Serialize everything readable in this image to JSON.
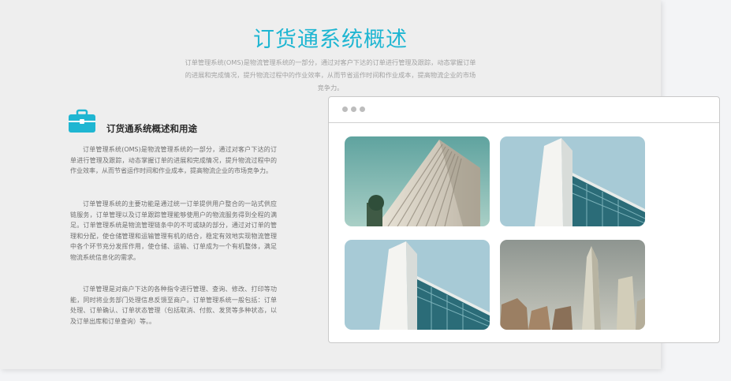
{
  "page": {
    "title": "订货通系统概述",
    "intro": "订单管理系统(OMS)是物流管理系统的一部分，通过对客户下达的订单进行管理及跟踪，动态掌握订单的进展和完成情况，提升物流过程中的作业效率，从而节省运作时间和作业成本，提高物流企业的市场竞争力。"
  },
  "feature": {
    "icon": "briefcase-icon",
    "title": "订货通系统概述和用途",
    "paragraphs": [
      "订单管理系统(OMS)是物流管理系统的一部分，通过对客户下达的订单进行管理及跟踪，动态掌握订单的进展和完成情况，提升物流过程中的作业效率，从而节省运作时间和作业成本，提高物流企业的市场竞争力。",
      "订单管理系统的主要功能是通过统一订单提供用户整合的一站式供应链服务，订单管理以及订单跟踪管理能够使用户的物流服务得到全程的满足。订单管理系统是物流管理链条中的不可或缺的部分，通过对订单的管理和分配，使仓储管理和运输管理有机的结合，稳定有效地实现物流管理中各个环节充分发挥作用，使仓储、运输、订单成为一个有机整体，满足物流系统信息化的需求。",
      "订单管理是对商户下达的各种指令进行管理、查询、修改、打印等功能，同时将业务部门处理信息反馈至商户。订单管理系统一般包括：订单处理、订单确认、订单状态管理（包括取消、付款、发货等多种状态，以及订单出库和订单查询）等。。"
    ]
  },
  "gallery": {
    "images": [
      {
        "name": "building-photo-1",
        "desc": "office-tower"
      },
      {
        "name": "building-photo-2",
        "desc": "white-glass-building"
      },
      {
        "name": "building-photo-3",
        "desc": "white-glass-building"
      },
      {
        "name": "building-photo-4",
        "desc": "skyscrapers"
      }
    ]
  },
  "colors": {
    "accent": "#1fb6d2",
    "panel": "#eeeeee"
  }
}
